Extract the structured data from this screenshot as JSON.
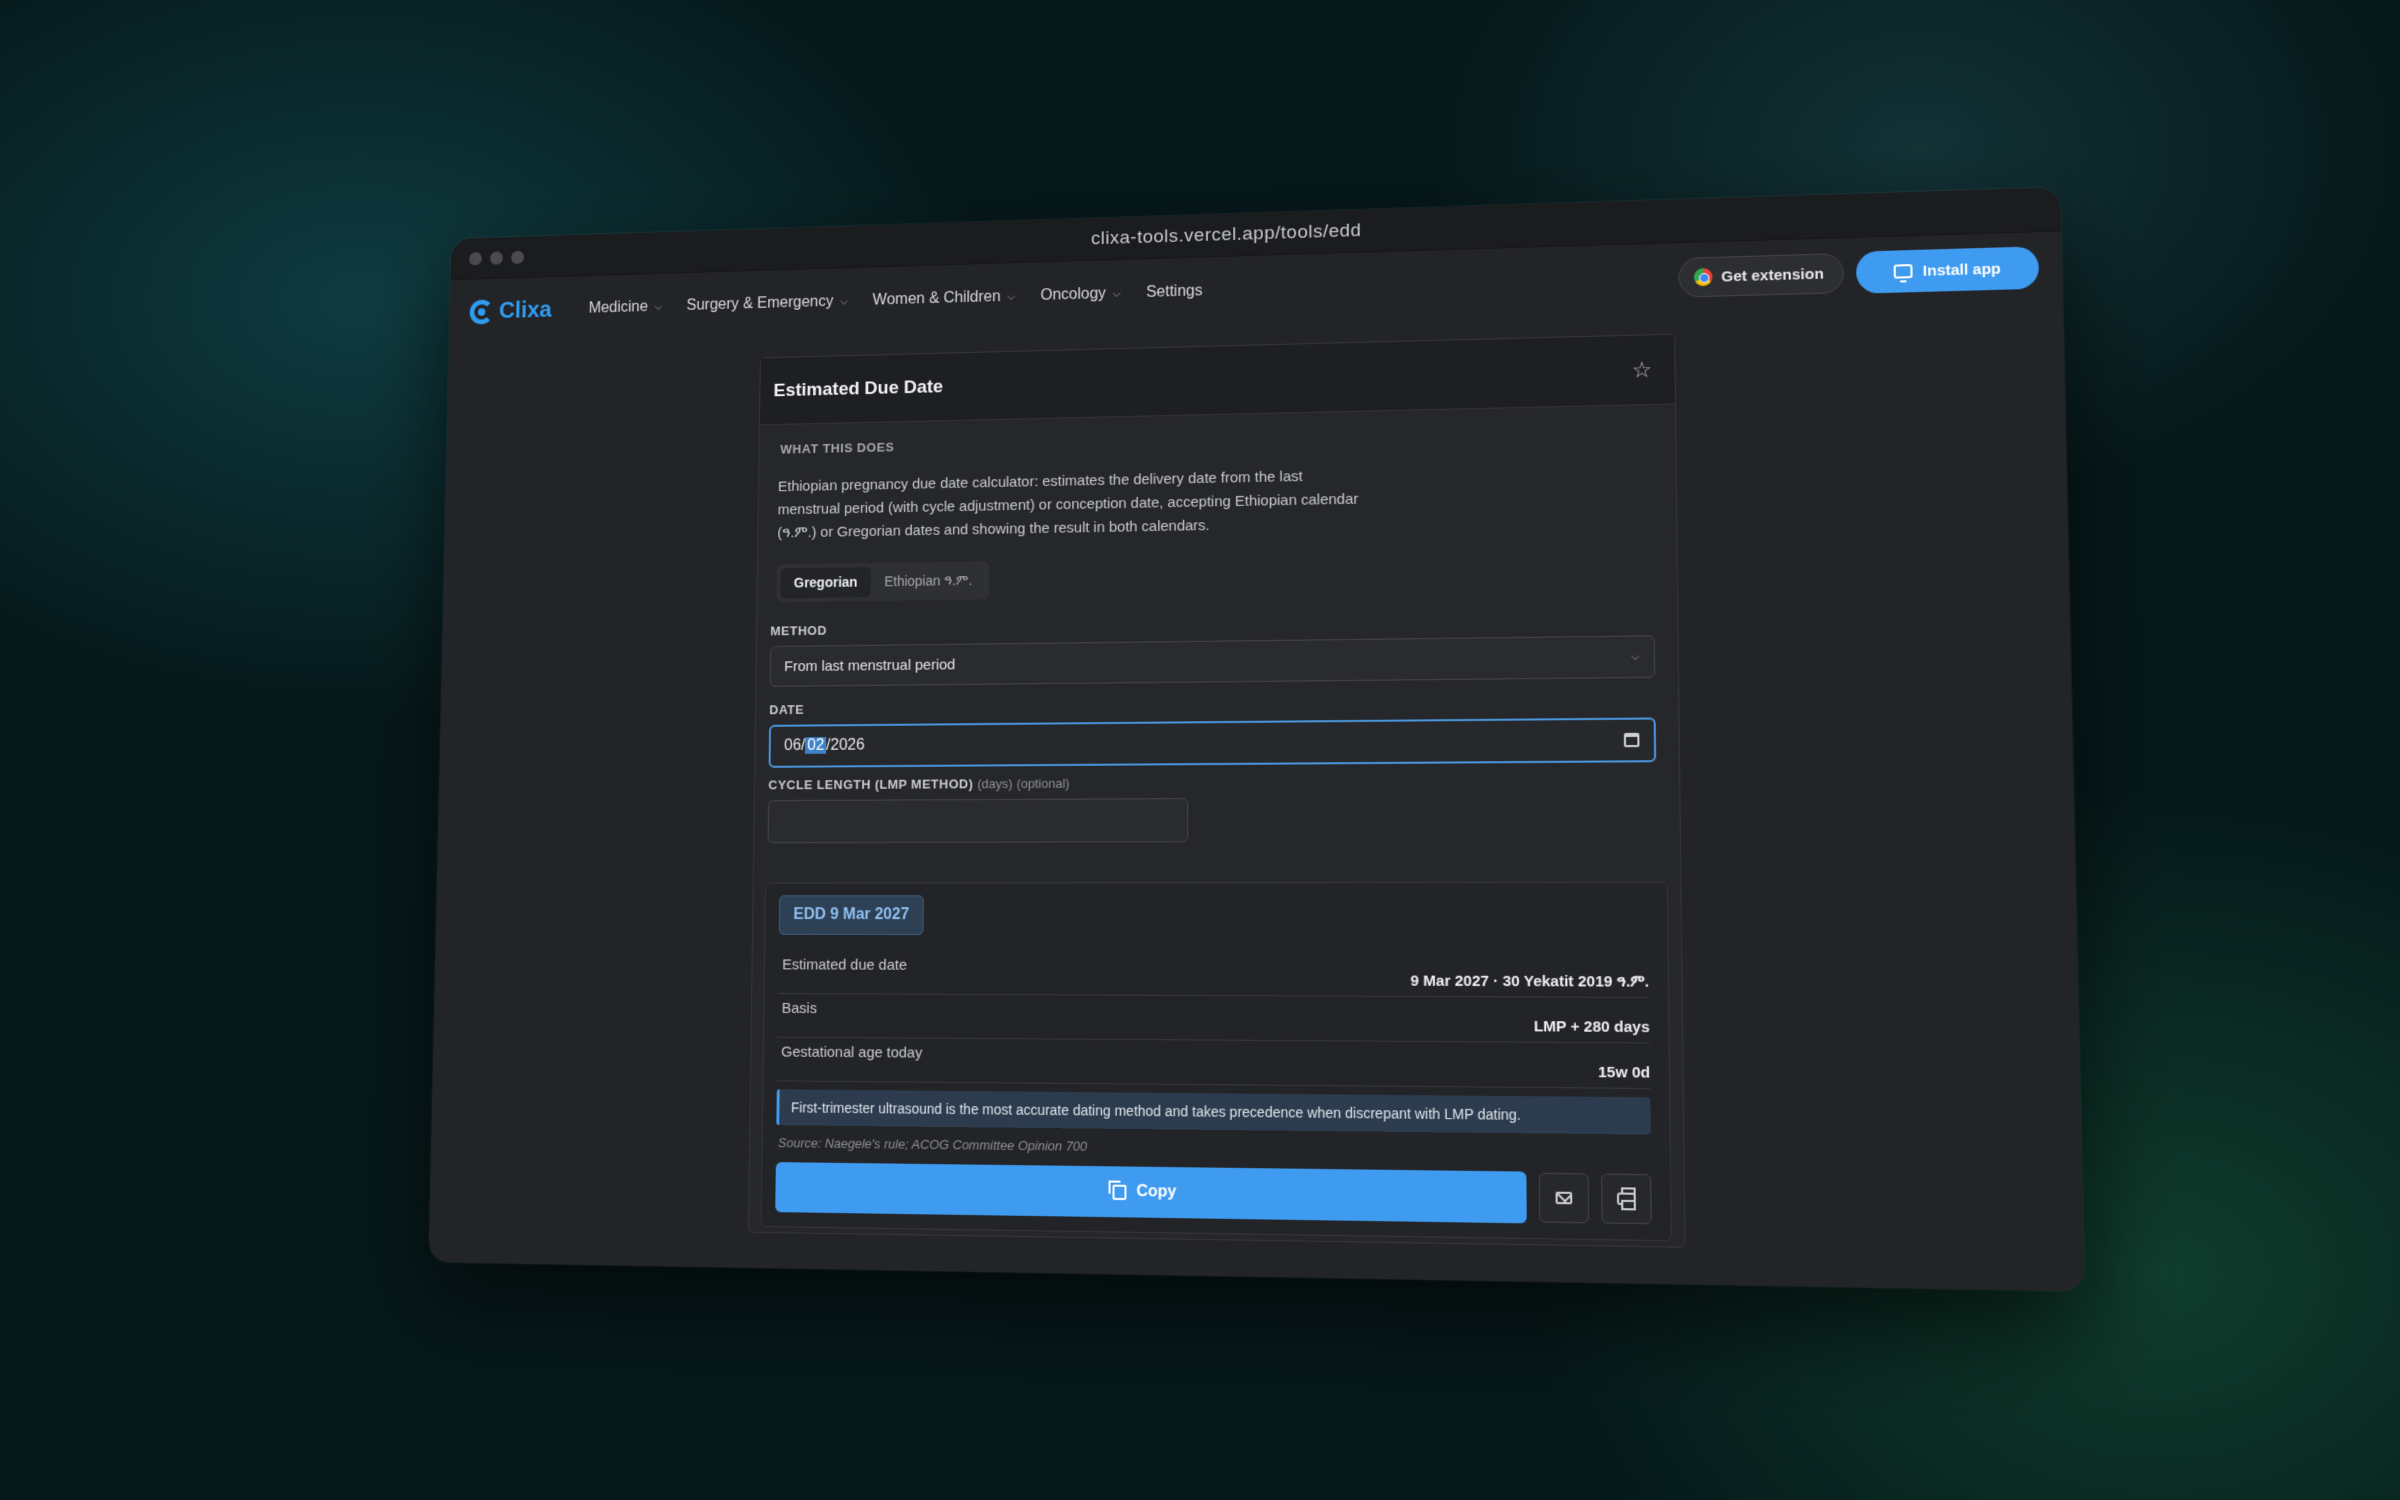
{
  "browser": {
    "url": "clixa-tools.vercel.app/tools/edd"
  },
  "nav": {
    "logo": "Clixa",
    "items": [
      {
        "label": "Medicine",
        "has_dropdown": true
      },
      {
        "label": "Surgery & Emergency",
        "has_dropdown": true
      },
      {
        "label": "Women & Children",
        "has_dropdown": true
      },
      {
        "label": "Oncology",
        "has_dropdown": true
      },
      {
        "label": "Settings",
        "has_dropdown": false
      }
    ],
    "extension_label": "Get extension",
    "install_label": "Install app"
  },
  "tool": {
    "title": "Estimated Due Date",
    "what_label": "WHAT THIS DOES",
    "description": "Ethiopian pregnancy due date calculator: estimates the delivery date from the last menstrual period (with cycle adjustment) or conception date, accepting Ethiopian calendar (ዓ.ም.) or Gregorian dates and showing the result in both calendars.",
    "calendar_tabs": [
      {
        "label": "Gregorian",
        "active": true
      },
      {
        "label": "Ethiopian ዓ.ም.",
        "active": false
      }
    ],
    "method": {
      "label": "METHOD",
      "value": "From last menstrual period"
    },
    "date": {
      "label": "DATE",
      "month": "06",
      "day": "02",
      "year": "2026"
    },
    "cycle": {
      "label": "CYCLE LENGTH (LMP METHOD)",
      "unit": "(days)",
      "optional": "(optional)",
      "value": ""
    }
  },
  "result": {
    "badge": "EDD 9 Mar 2027",
    "rows": [
      {
        "label": "Estimated due date",
        "value": "9 Mar 2027 · 30 Yekatit 2019 ዓ.ም."
      },
      {
        "label": "Basis",
        "value": "LMP + 280 days"
      },
      {
        "label": "Gestational age today",
        "value": "15w 0d"
      }
    ],
    "note": "First-trimester ultrasound is the most accurate dating method and takes precedence when discrepant with LMP dating.",
    "source": "Source: Naegele's rule; ACOG Committee Opinion 700",
    "copy_label": "Copy"
  },
  "colors": {
    "accent": "#3e9bf0",
    "background": "#232427",
    "brand": "#2f9cf0"
  }
}
